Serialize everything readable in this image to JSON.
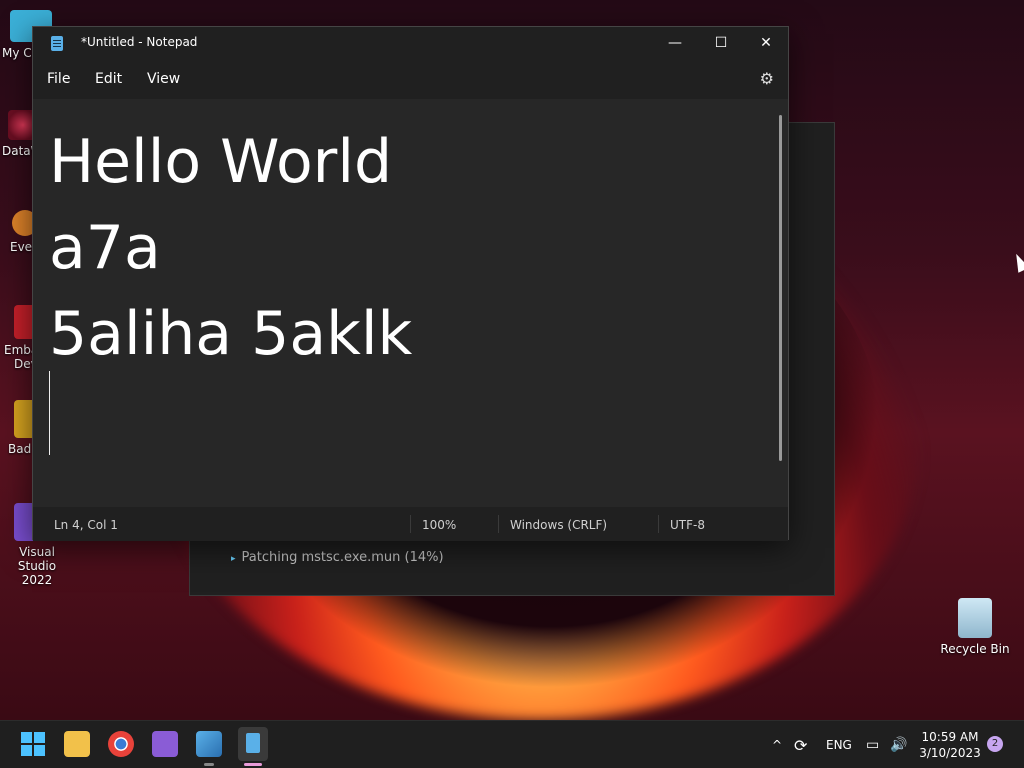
{
  "desktop": {
    "icons": [
      {
        "label": "My Co"
      },
      {
        "label": "DataW"
      },
      {
        "label": "Ever"
      },
      {
        "label": "Emba"
      },
      {
        "label": "Dev"
      },
      {
        "label": "Bad"
      },
      {
        "label": "Visual Studio"
      },
      {
        "label": "2022"
      }
    ],
    "recycle_bin": {
      "label": "Recycle Bin"
    }
  },
  "background_window": {
    "status_text": "Patching mstsc.exe.mun (14%)"
  },
  "notepad": {
    "title": "*Untitled - Notepad",
    "menu": {
      "file": "File",
      "edit": "Edit",
      "view": "View"
    },
    "content": {
      "lines": [
        "Hello World",
        "a7a",
        "5aliha 5aklk"
      ]
    },
    "status": {
      "position": "Ln 4, Col 1",
      "zoom": "100%",
      "line_ending": "Windows (CRLF)",
      "encoding": "UTF-8"
    },
    "controls": {
      "minimize": "—",
      "maximize": "☐",
      "close": "✕",
      "settings": "⚙"
    }
  },
  "taskbar": {
    "tray": {
      "chevron": "^",
      "language": "ENG",
      "time": "10:59 AM",
      "date": "3/10/2023",
      "notification_count": "2"
    }
  },
  "colors": {
    "notepad_bg": "#272727",
    "titlebar_bg": "#202020",
    "taskbar_bg": "#1f1f1f",
    "accent": "#5ab0e8"
  }
}
